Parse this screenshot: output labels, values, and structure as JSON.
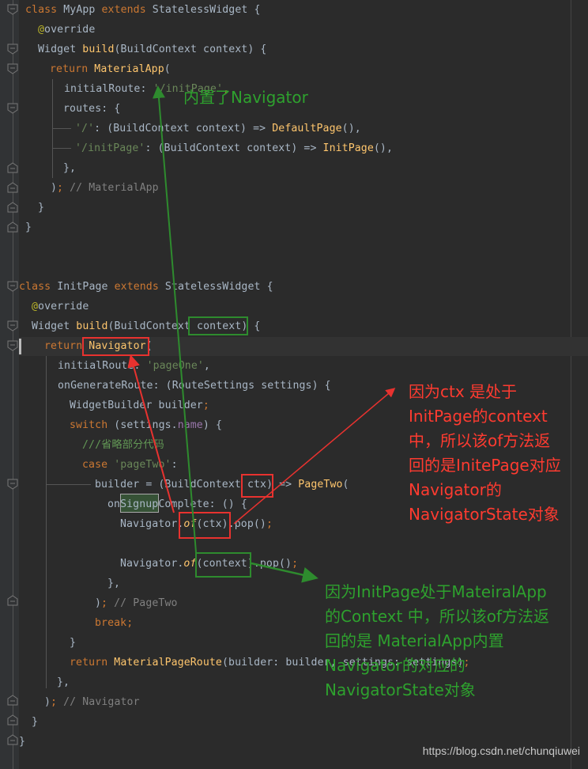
{
  "editor": {
    "theme_colors": {
      "background": "#2b2b2b",
      "keyword": "#cc7832",
      "function": "#ffc66d",
      "string": "#6a8759",
      "comment": "#808080",
      "annotation": "#bbb529",
      "property": "#9876aa",
      "text": "#a9b7c6"
    },
    "lines": {
      "l1": {
        "kw1": "class",
        "t1": " MyApp ",
        "kw2": "extends",
        "t2": " StatelessWidget {"
      },
      "l2": {
        "ann": "@",
        "t1": "override"
      },
      "l3": {
        "t1": "Widget ",
        "fn": "build",
        "t2": "(BuildContext context) {"
      },
      "l4": {
        "kw": "return",
        "t1": " ",
        "fn": "MaterialApp",
        "t2": "("
      },
      "l5": {
        "t1": "initialRoute: ",
        "str": "'/initPage'",
        "p": ","
      },
      "l6": {
        "t1": "routes: {"
      },
      "l7": {
        "str": "'/'",
        "t1": ": (BuildContext context) => ",
        "fn": "DefaultPage",
        "t2": "(),"
      },
      "l8": {
        "str": "'/initPage'",
        "t1": ": (BuildContext context) => ",
        "fn": "InitPage",
        "t2": "(),"
      },
      "l9": {
        "t1": "},"
      },
      "l10": {
        "t1": ")",
        "p": ";",
        "cmt": " // MaterialApp"
      },
      "l11": {
        "t1": "}"
      },
      "l12": {
        "t1": "}"
      },
      "l13": {
        "kw1": "class",
        "t1": " InitPage ",
        "kw2": "extends",
        "t2": " StatelessWidget {"
      },
      "l14": {
        "ann": "@",
        "t1": "override"
      },
      "l15": {
        "t1": "Widget ",
        "fn": "build",
        "t2": "(BuildContext context) {"
      },
      "l16": {
        "kw": "return",
        "t1": " ",
        "fn": "Navigator",
        "t2": "("
      },
      "l17": {
        "t1": "initialRoute: ",
        "str": "'pageOne'",
        "t2": ","
      },
      "l18": {
        "t1": "onGenerateRoute: (RouteSettings settings) {"
      },
      "l19": {
        "t1": "WidgetBuilder builder",
        "p": ";"
      },
      "l20": {
        "kw": "switch",
        "t1": " (settings.",
        "prop": "name",
        "t2": ") {"
      },
      "l21": {
        "doc": "///省略部分代码"
      },
      "l22": {
        "kw": "case",
        "t1": " ",
        "str": "'pageTwo'",
        "t2": ":"
      },
      "l23": {
        "t1": "builder = (BuildContext ctx) => ",
        "fn": "PageTwo",
        "t2": "("
      },
      "l24": {
        "t1a": "on",
        "sel": "Signup",
        "t1b": "Complete: () {"
      },
      "l25": {
        "t1": "Navigator.",
        "it": "of",
        "t2": "(ctx).pop()",
        "p": ";"
      },
      "l26": {
        "t1": "Navigator.",
        "it": "of",
        "t2": "(context).pop()",
        "p": ";"
      },
      "l27": {
        "t1": "},"
      },
      "l28": {
        "t1": ")",
        "p": ";",
        "cmt": " // PageTwo"
      },
      "l29": {
        "kw": "break",
        "p": ";"
      },
      "l30": {
        "t1": "}"
      },
      "l31": {
        "kw": "return",
        "t1": " ",
        "fn": "MaterialPageRoute",
        "t2": "(builder: builder, settings: settings)",
        "p": ";"
      },
      "l32": {
        "t1": "},"
      },
      "l33": {
        "t1": ")",
        "p": ";",
        "cmt": " // Navigator"
      },
      "l34": {
        "t1": "}"
      },
      "l35": {
        "t1": "}"
      }
    }
  },
  "annotations": {
    "green_top": "内置了Navigator",
    "red_note": "因为ctx 是处于\nInitPage的context\n中，所以该of方法返\n回的是InitePage对应\nNavigator的\nNavigatorState对象",
    "green_note": "因为InitPage处于MateiralApp\n的Context 中，所以该of方法返\n回的是 MaterialApp内置\nNavigator的对应的\nNavigatorState对象",
    "red_color": "#ff3b30",
    "green_color": "#2ea12e"
  },
  "watermark": "https://blog.csdn.net/chunqiuwei"
}
